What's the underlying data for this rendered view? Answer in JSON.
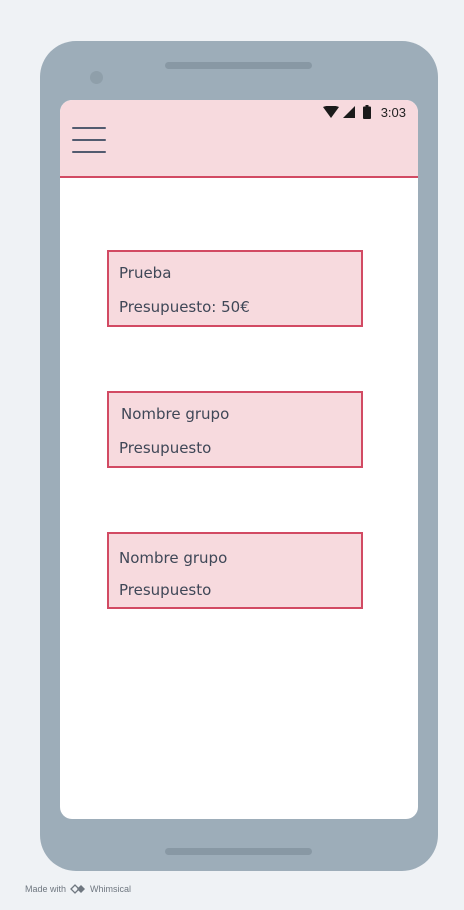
{
  "status_bar": {
    "time": "3:03",
    "icons": [
      "wifi-icon",
      "cell-signal-icon",
      "battery-icon"
    ]
  },
  "app_bar": {
    "menu_icon": "hamburger-menu-icon"
  },
  "groups": [
    {
      "name": "Prueba",
      "budget": "Presupuesto: 50€"
    },
    {
      "name": "Nombre grupo",
      "budget": "Presupuesto"
    },
    {
      "name": "Nombre grupo",
      "budget": "Presupuesto"
    }
  ],
  "footer": {
    "made_with": "Made with",
    "brand": "Whimsical"
  },
  "colors": {
    "background": "#eff2f5",
    "phone_body": "#9dadb9",
    "accent": "#d24a63",
    "card_fill": "#f7dade",
    "text": "#3f4757"
  }
}
